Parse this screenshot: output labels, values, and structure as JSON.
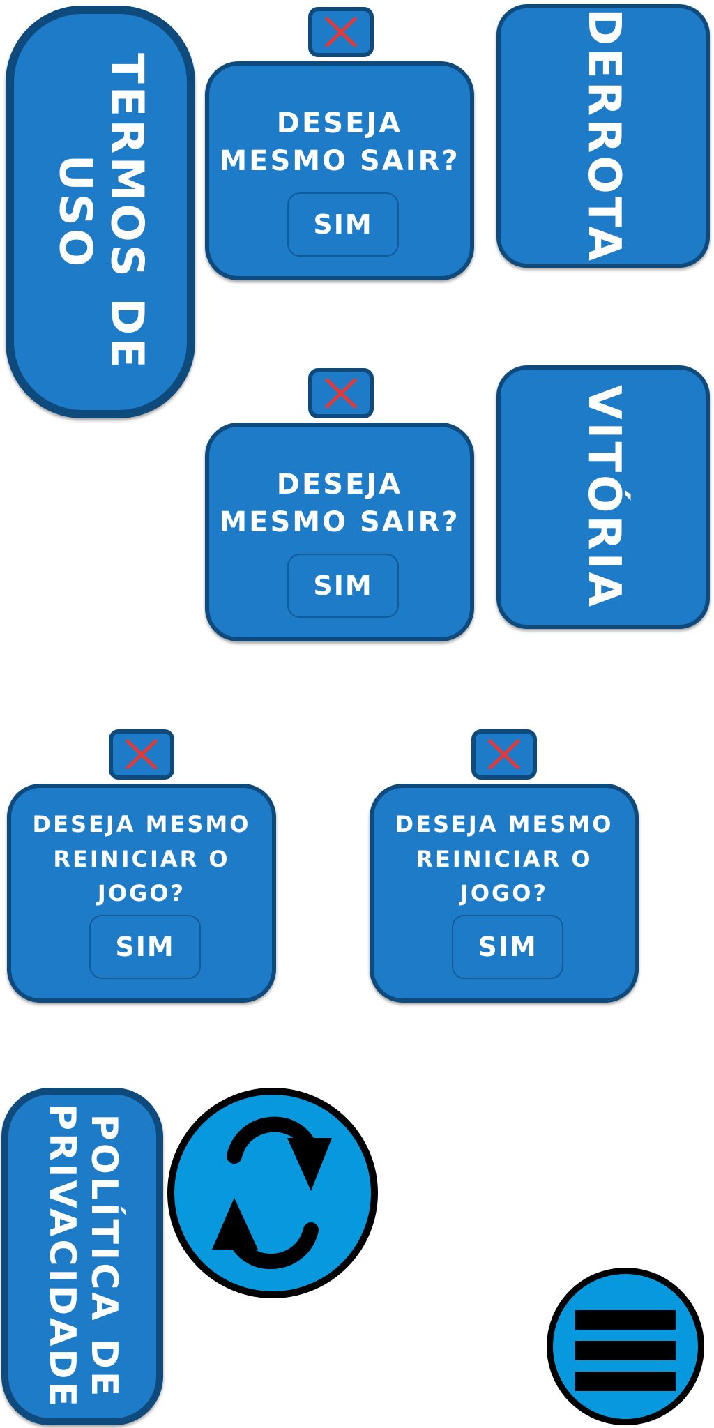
{
  "panels": {
    "terms": "TERMOS DE USO",
    "defeat": "DERROTA",
    "victory": "VITÓRIA",
    "privacy": "POLÍTICA DE PRIVACIDADE"
  },
  "dialogs": [
    {
      "title_line1": "DESEJA",
      "title_line2": "MESMO SAIR?",
      "confirm": "SIM"
    },
    {
      "title_line1": "DESEJA",
      "title_line2": "MESMO SAIR?",
      "confirm": "SIM"
    },
    {
      "title_line1": "DESEJA MESMO",
      "title_line2": "REINICIAR O",
      "title_line3": "JOGO?",
      "confirm": "SIM"
    },
    {
      "title_line1": "DESEJA MESMO",
      "title_line2": "REINICIAR O",
      "title_line3": "JOGO?",
      "confirm": "SIM"
    }
  ],
  "icons": {
    "close": "close-icon",
    "restart": "restart-icon",
    "menu": "hamburger-menu-icon"
  },
  "colors": {
    "panel_fill": "#1e7bc8",
    "panel_border": "#0f4a7c",
    "close_x": "#e53935",
    "round_button_fill": "#0798dd"
  }
}
